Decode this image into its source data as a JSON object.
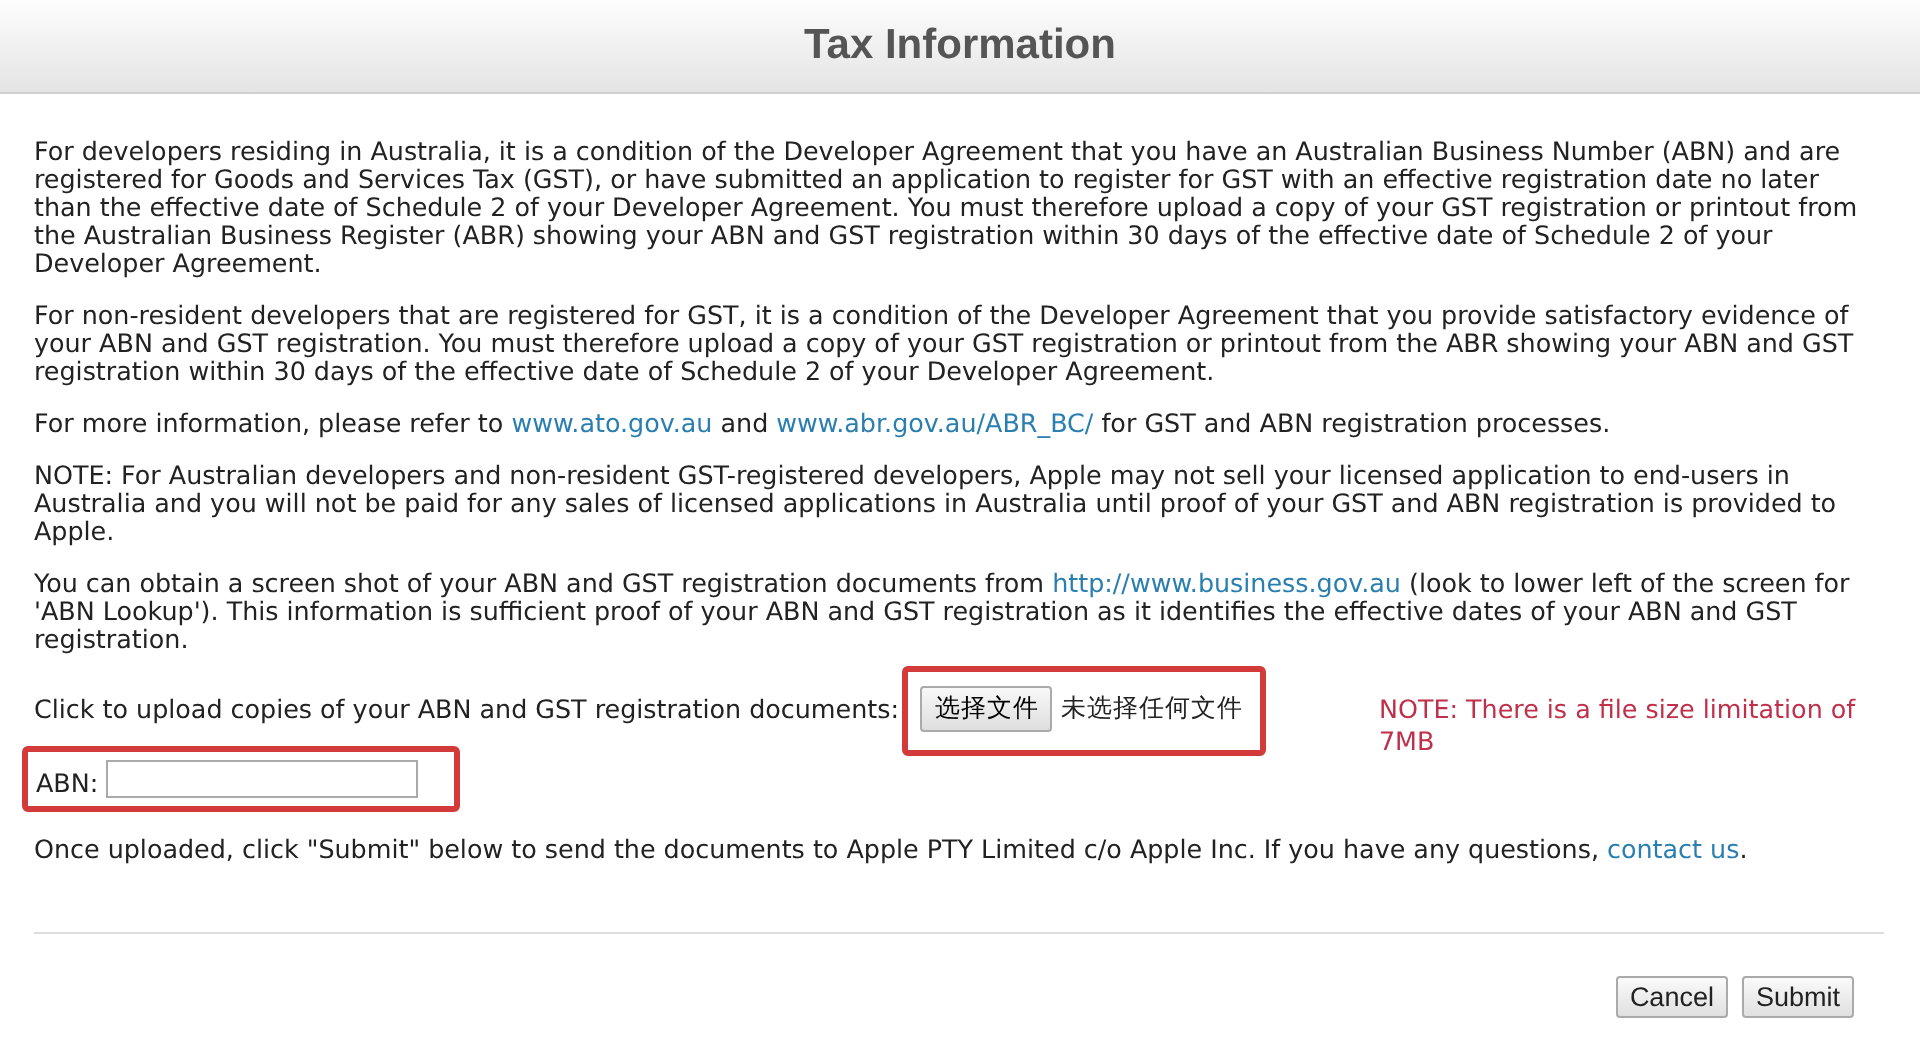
{
  "window": {
    "title": "Tax Information"
  },
  "paragraphs": [
    [
      {
        "kind": "text",
        "text": "For developers residing in Australia, it is a condition of the Developer Agreement that you have an Australian Business Number (ABN) and are registered for Goods and Services Tax (GST), or have submitted an application to register for GST with an effective registration date no later than the effective date of Schedule 2 of your Developer Agreement. You must therefore upload a copy of your GST registration or printout from the Australian Business Register (ABR) showing your ABN and GST registration within 30 days of the effective date of Schedule 2 of your Developer Agreement."
      }
    ],
    [
      {
        "kind": "text",
        "text": "For non-resident developers that are registered for GST, it is a condition of the Developer Agreement that you provide satisfactory evidence of your ABN and GST registration. You must therefore upload a copy of your GST registration or printout from the ABR showing your ABN and GST registration within 30 days of the effective date of Schedule 2 of your Developer Agreement."
      }
    ],
    [
      {
        "kind": "text",
        "text": "For more information, please refer to "
      },
      {
        "kind": "link",
        "text": "www.ato.gov.au"
      },
      {
        "kind": "text",
        "text": " and "
      },
      {
        "kind": "link",
        "text": "www.abr.gov.au/ABR_BC/"
      },
      {
        "kind": "text",
        "text": " for GST and ABN registration processes."
      }
    ],
    [
      {
        "kind": "text",
        "text": "NOTE: For Australian developers and non-resident GST-registered developers, Apple may not sell your licensed application to end-users in Australia and you will not be paid for any sales of licensed applications in Australia until proof of your GST and ABN registration is provided to Apple."
      }
    ],
    [
      {
        "kind": "text",
        "text": "You can obtain a screen shot of your ABN and GST registration documents from "
      },
      {
        "kind": "link",
        "text": "http://www.business.gov.au"
      },
      {
        "kind": "text",
        "text": " (look to lower left of the screen for 'ABN Lookup'). This information is sufficient proof of your ABN and GST registration as it identifies the effective dates of your ABN and GST registration."
      }
    ]
  ],
  "upload": {
    "label": "Click to upload copies of your ABN and GST registration documents:",
    "button": "选择文件",
    "status": "未选择任何文件",
    "highlighted": true,
    "note": "NOTE: There is a file size limitation of 7MB"
  },
  "abn": {
    "label": "ABN:",
    "highlighted": true
  },
  "closing": [
    {
      "kind": "text",
      "text": "Once uploaded, click \"Submit\" below to send the documents to Apple PTY Limited c/o Apple Inc. If you have any questions, "
    },
    {
      "kind": "link",
      "text": "contact us"
    },
    {
      "kind": "text",
      "text": "."
    }
  ],
  "buttons": [
    "Cancel",
    "Submit"
  ]
}
